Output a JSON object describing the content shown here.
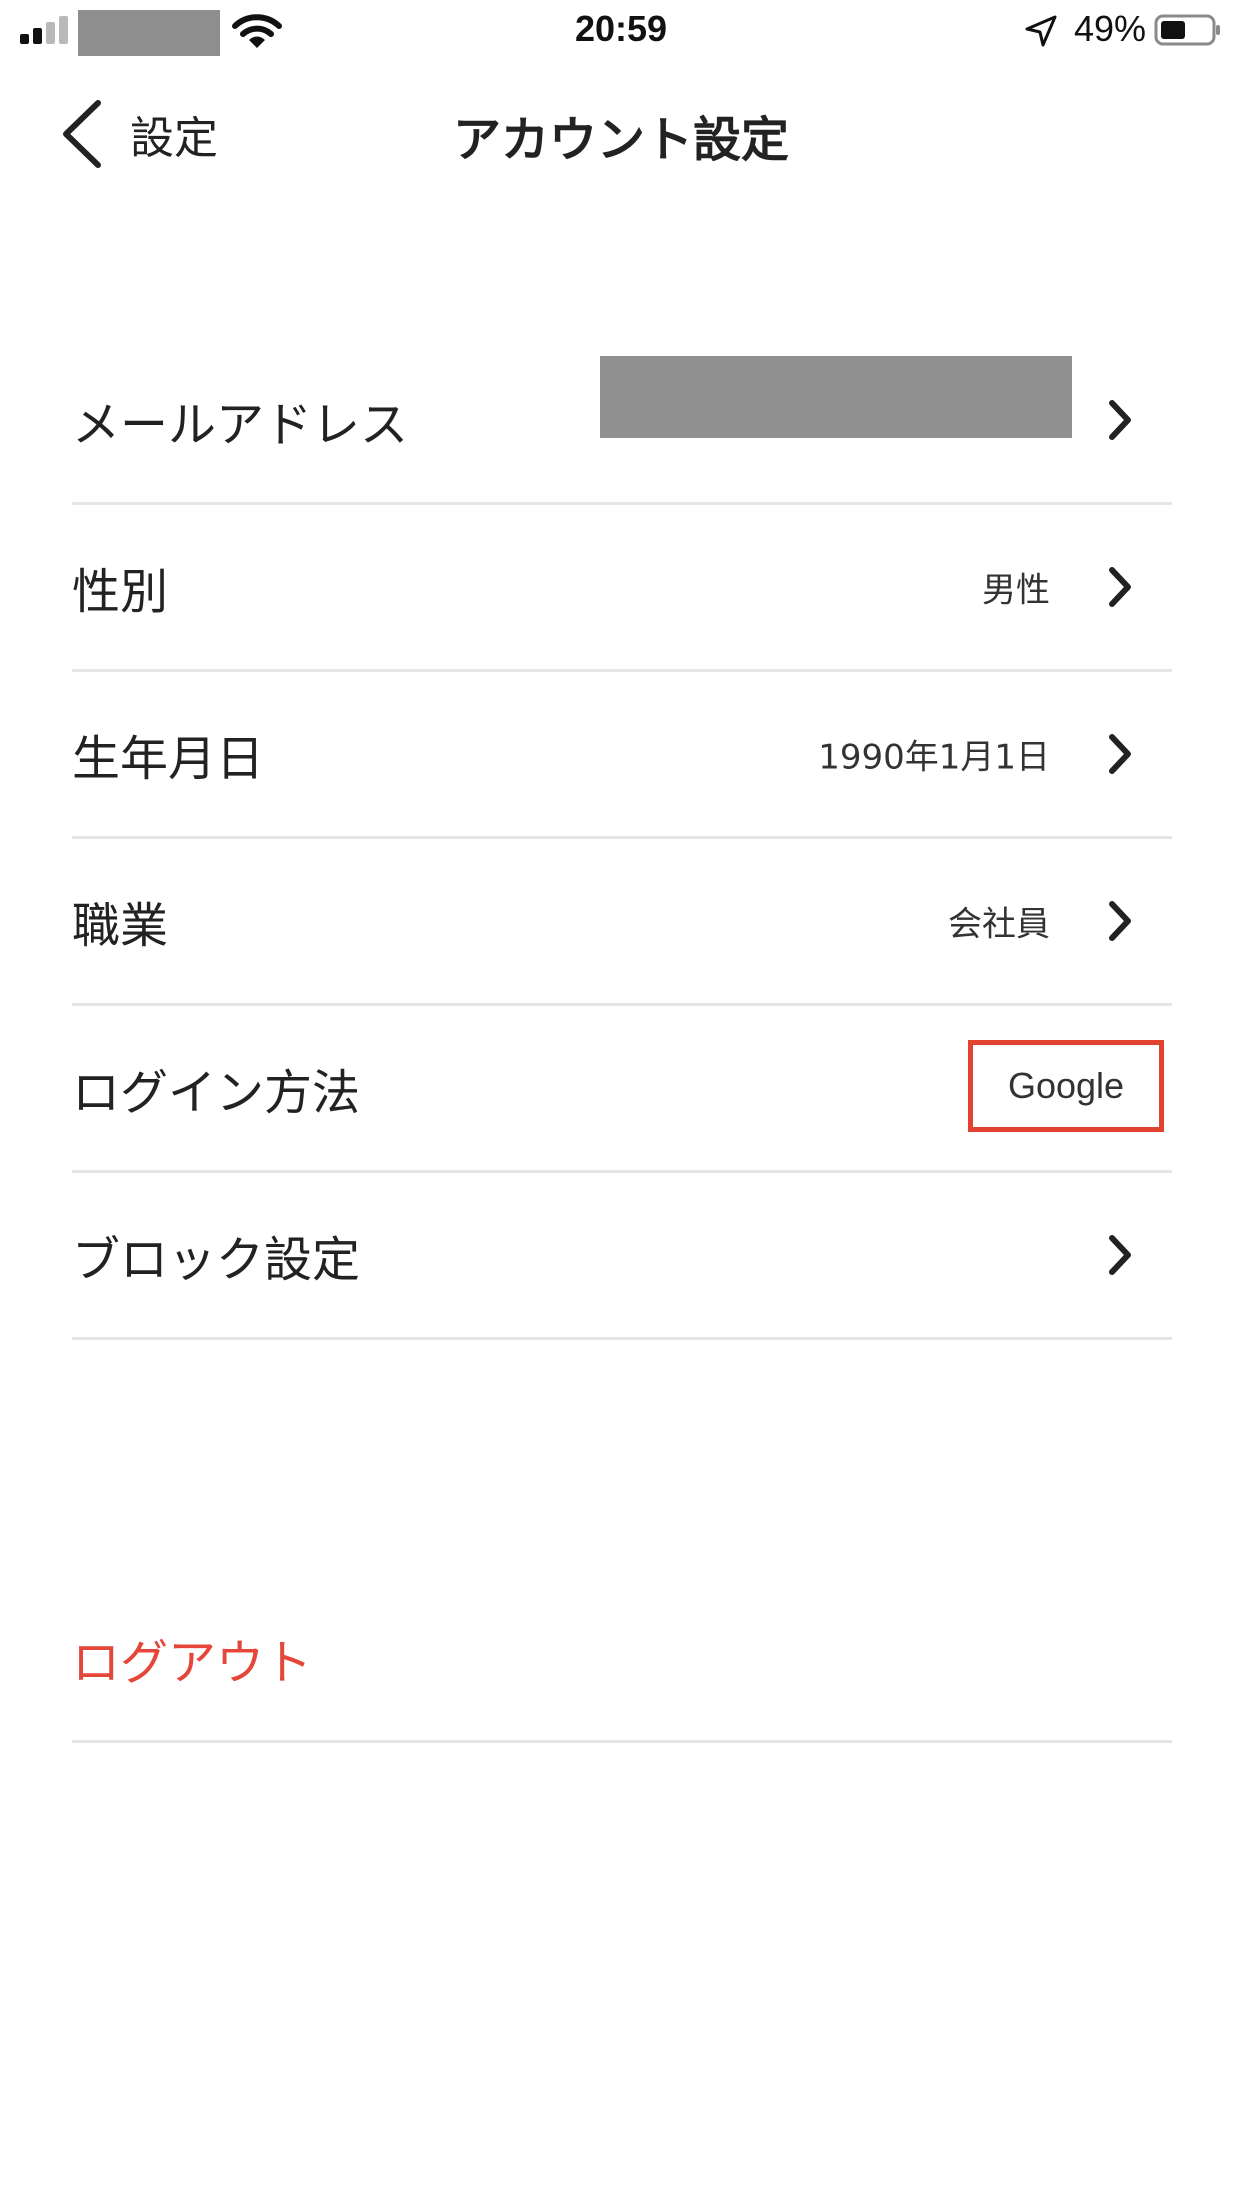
{
  "status_bar": {
    "time": "20:59",
    "battery_percent": "49%"
  },
  "nav": {
    "back_label": "設定",
    "title": "アカウント設定"
  },
  "rows": [
    {
      "label": "メールアドレス",
      "value": "",
      "has_chevron": true
    },
    {
      "label": "性別",
      "value": "男性",
      "has_chevron": true
    },
    {
      "label": "生年月日",
      "value": "1990年1月1日",
      "has_chevron": true
    },
    {
      "label": "職業",
      "value": "会社員",
      "has_chevron": true
    },
    {
      "label": "ログイン方法",
      "value": "Google",
      "has_chevron": false
    },
    {
      "label": "ブロック設定",
      "value": "",
      "has_chevron": true
    }
  ],
  "logout_label": "ログアウト",
  "colors": {
    "destructive": "#e4473a",
    "highlight_border": "#e24330",
    "redaction": "#919191"
  }
}
